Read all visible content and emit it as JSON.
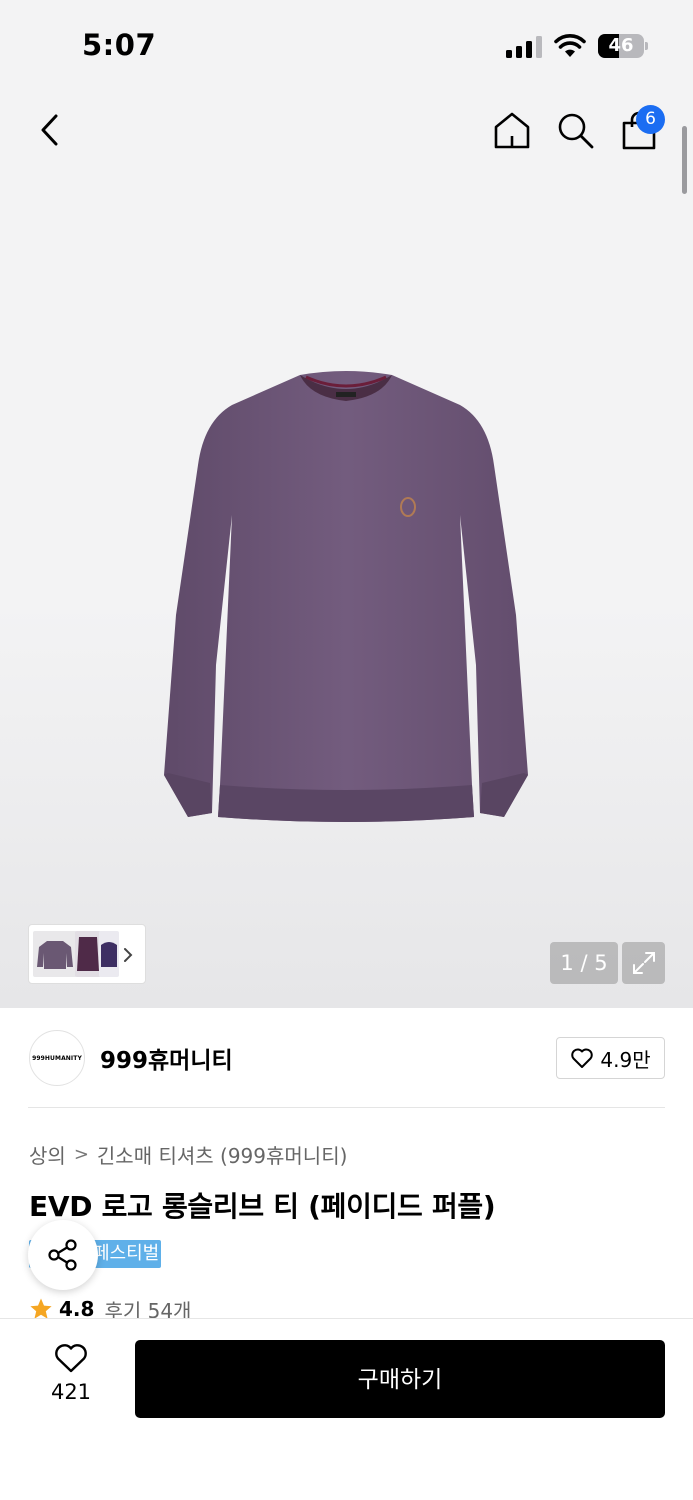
{
  "status_bar": {
    "time": "5:07",
    "battery_percent": "46",
    "battery_level": 0.46,
    "signal_bars_active": 3,
    "signal_bars_total": 4
  },
  "nav": {
    "cart_count": "6",
    "icons": [
      "chevron-left-icon",
      "home-icon",
      "search-icon",
      "shopping-bag-icon"
    ]
  },
  "gallery": {
    "counter": "1 / 5",
    "product_color": "#6f5878"
  },
  "brand": {
    "logo_text": "999HUMANITY",
    "name": "999휴머니티",
    "likes": "4.9만"
  },
  "breadcrumb": {
    "category": "상의",
    "separator": ">",
    "subcategory": "긴소매 티셔츠 (999휴머니티)"
  },
  "product": {
    "title": "EVD 로고 롱슬리브 티 (페이디드 퍼플)",
    "badge": "페스티벌",
    "rating": "4.8",
    "reviews": "후기 54개"
  },
  "bottom_bar": {
    "wish_count": "421",
    "buy_label": "구매하기"
  },
  "colors": {
    "accent_blue": "#1b6df2",
    "badge_blue": "#5fb0e9",
    "star": "#f5a623",
    "buy_button": "#000000"
  }
}
